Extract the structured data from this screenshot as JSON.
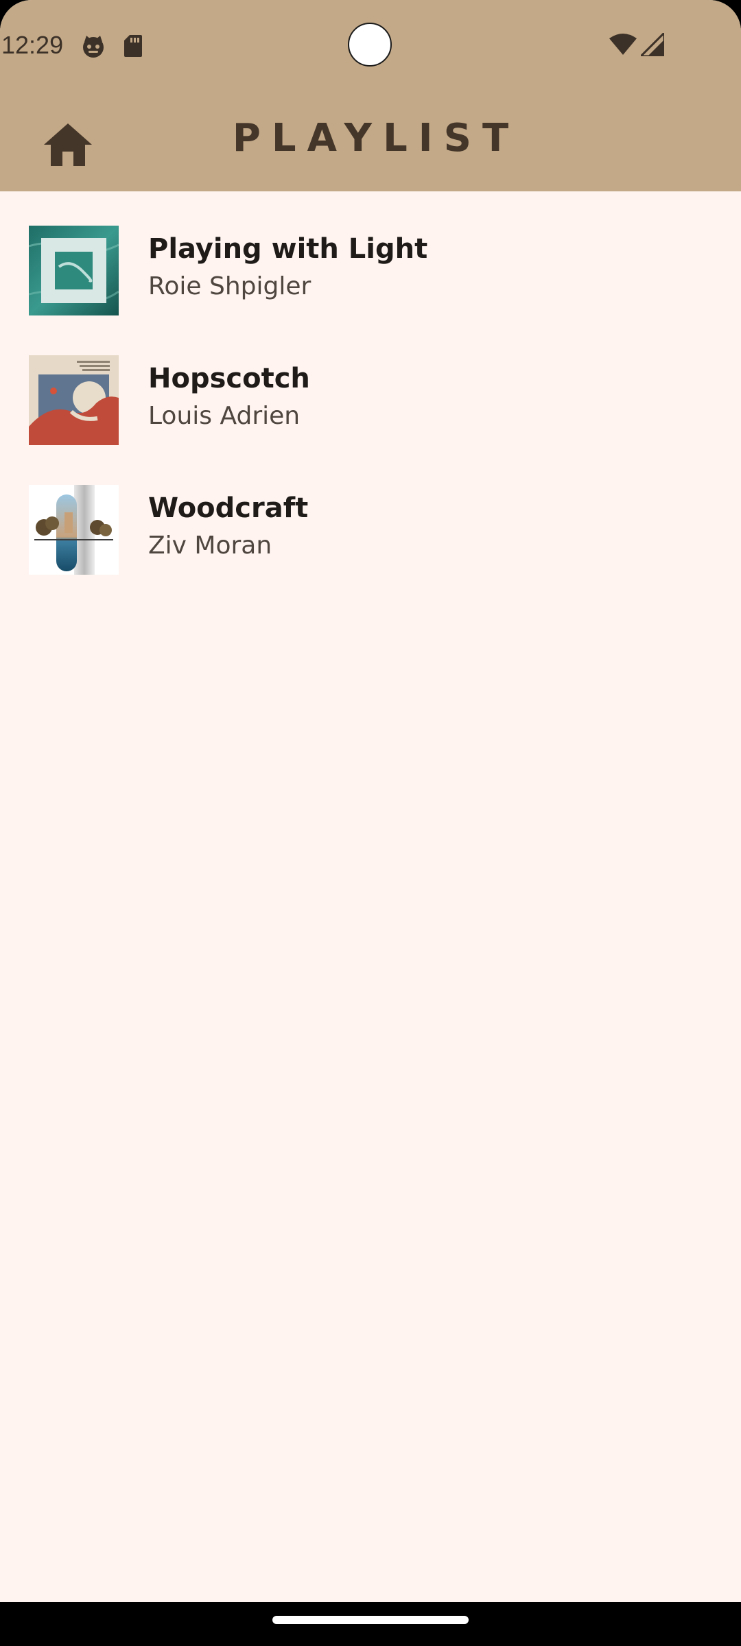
{
  "status_bar": {
    "time": "12:29",
    "icons": [
      "cat-face-icon",
      "sd-card-icon",
      "wifi-icon",
      "cell-signal-icon"
    ],
    "background": "#C3A987"
  },
  "app_bar": {
    "title": "PLAYLIST",
    "home_icon": "home-icon",
    "background": "#C3A987"
  },
  "playlist": {
    "background": "#FFF4F0",
    "tracks": [
      {
        "title": "Playing with Light",
        "artist": "Roie Shpigler"
      },
      {
        "title": "Hopscotch",
        "artist": "Louis Adrien"
      },
      {
        "title": "Woodcraft",
        "artist": "Ziv Moran"
      }
    ]
  },
  "colors": {
    "accent": "#C3A987",
    "title_text": "#45362A",
    "track_title": "#1E1B19",
    "track_artist": "#4F4640"
  }
}
